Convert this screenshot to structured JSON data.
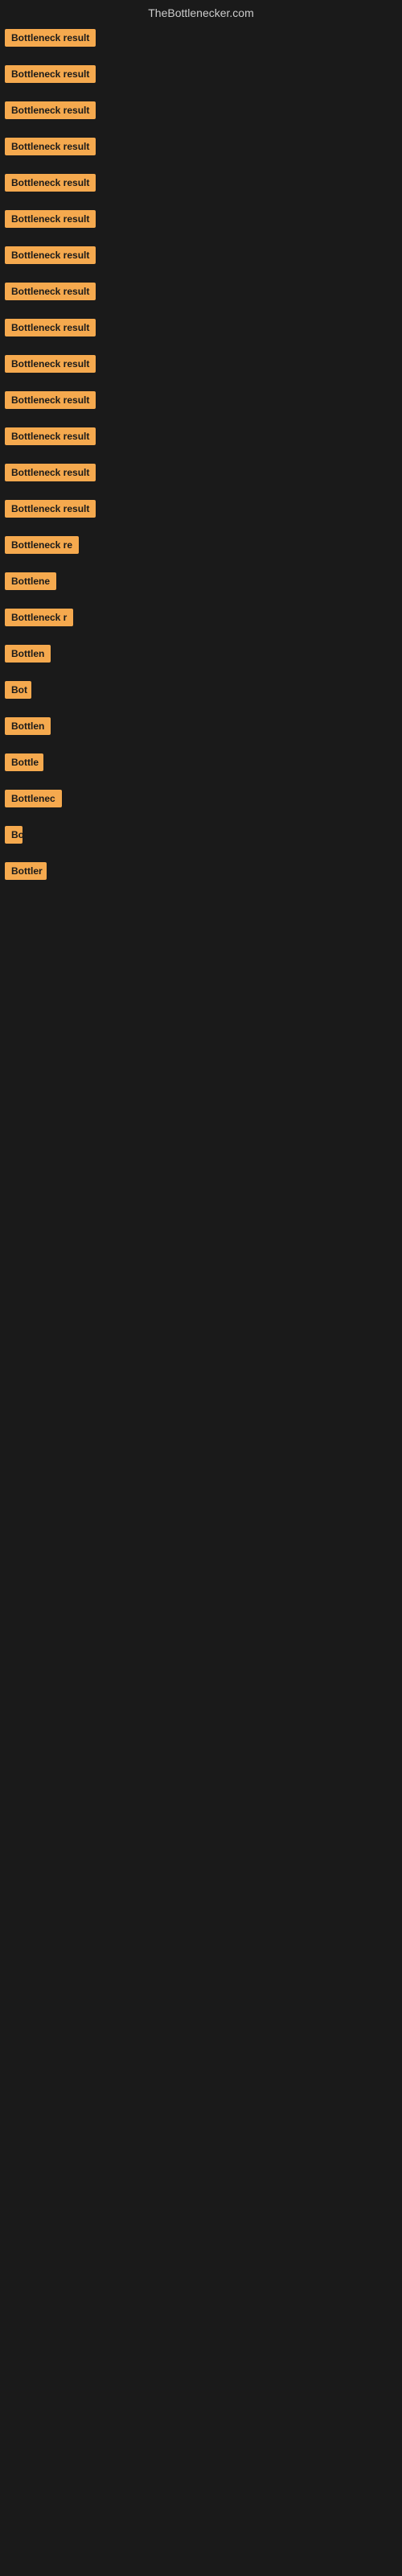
{
  "header": {
    "title": "TheBottlenecker.com"
  },
  "items": [
    {
      "label": "Bottleneck result",
      "width": "full"
    },
    {
      "label": "Bottleneck result",
      "width": "full"
    },
    {
      "label": "Bottleneck result",
      "width": "full"
    },
    {
      "label": "Bottleneck result",
      "width": "full"
    },
    {
      "label": "Bottleneck result",
      "width": "full"
    },
    {
      "label": "Bottleneck result",
      "width": "full"
    },
    {
      "label": "Bottleneck result",
      "width": "full"
    },
    {
      "label": "Bottleneck result",
      "width": "full"
    },
    {
      "label": "Bottleneck result",
      "width": "full"
    },
    {
      "label": "Bottleneck result",
      "width": "full"
    },
    {
      "label": "Bottleneck result",
      "width": "full"
    },
    {
      "label": "Bottleneck result",
      "width": "full"
    },
    {
      "label": "Bottleneck result",
      "width": "full"
    },
    {
      "label": "Bottleneck result",
      "width": "full"
    },
    {
      "label": "Bottleneck re",
      "width": "partial1"
    },
    {
      "label": "Bottlene",
      "width": "partial2"
    },
    {
      "label": "Bottleneck r",
      "width": "partial3"
    },
    {
      "label": "Bottlen",
      "width": "partial4"
    },
    {
      "label": "Bot",
      "width": "partial5"
    },
    {
      "label": "Bottlen",
      "width": "partial4"
    },
    {
      "label": "Bottle",
      "width": "partial6"
    },
    {
      "label": "Bottlenec",
      "width": "partial7"
    },
    {
      "label": "Bo",
      "width": "partial8"
    },
    {
      "label": "Bottler",
      "width": "partial9"
    }
  ],
  "badge_color": "#f5a94e"
}
